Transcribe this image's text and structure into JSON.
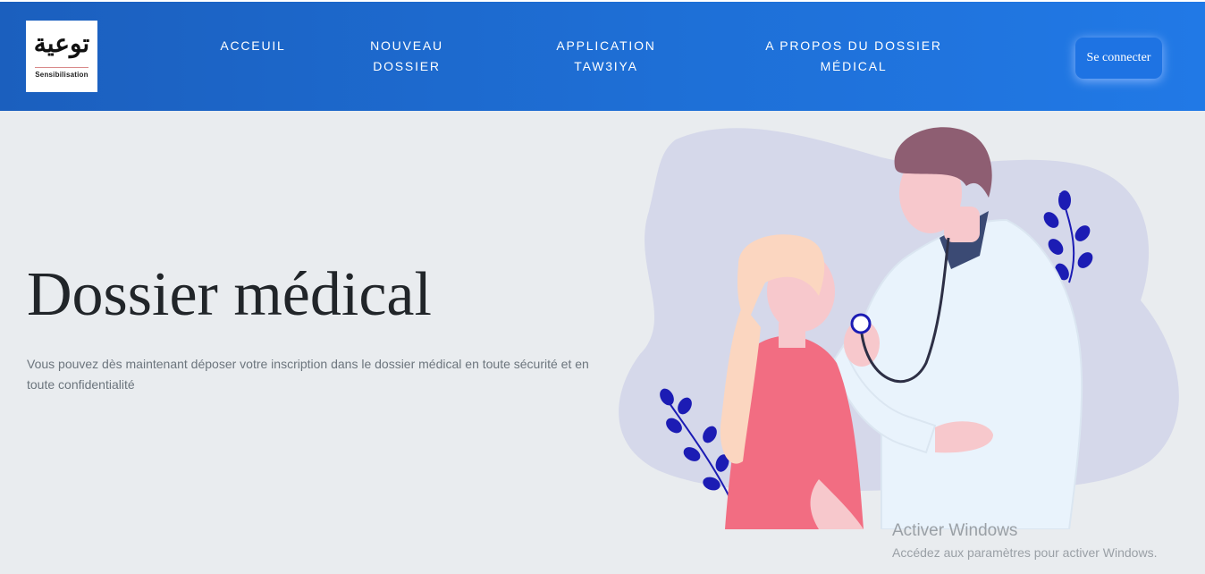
{
  "header": {
    "logo": {
      "arabic_text": "توعية",
      "subtitle": "Sensibilisation"
    },
    "nav": [
      {
        "line1": "ACCEUIL",
        "line2": ""
      },
      {
        "line1": "NOUVEAU",
        "line2": "DOSSIER"
      },
      {
        "line1": "APPLICATION",
        "line2": "TAW3IYA"
      },
      {
        "line1": "A PROPOS DU DOSSIER",
        "line2": "MÉDICAL"
      }
    ],
    "login_label": "Se connecter"
  },
  "hero": {
    "title": "Dossier médical",
    "text": "Vous pouvez dès maintenant déposer votre inscription dans le dossier médical en toute sécurité et en toute confidentialité",
    "illustration_icon": "doctor-patient-illustration"
  },
  "watermark": {
    "title": "Activer Windows",
    "subtitle": "Accédez aux paramètres pour activer Windows."
  },
  "colors": {
    "header_start": "#1b5fbe",
    "header_end": "#2179e6",
    "background": "#e9ecef",
    "leaf": "#1c1cb4",
    "blob": "#d5d8ea"
  }
}
